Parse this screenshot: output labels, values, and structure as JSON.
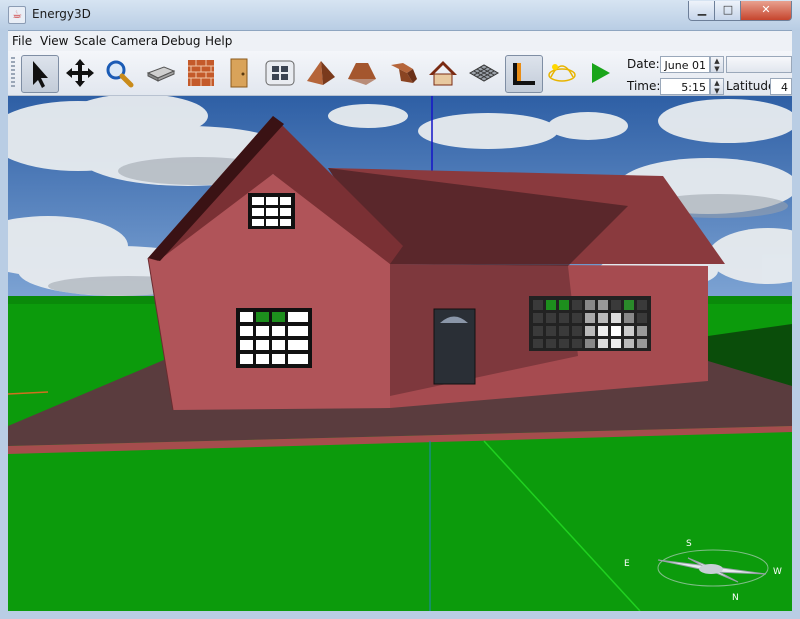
{
  "window": {
    "title": "Energy3D",
    "minimize": "▁",
    "maximize": "□",
    "close": "✕"
  },
  "menu": [
    "File",
    "View",
    "Scale",
    "Camera",
    "Debug",
    "Help"
  ],
  "toolbar": {
    "tools": [
      {
        "name": "select-tool",
        "icon": "arrow-cursor-icon",
        "active": true
      },
      {
        "name": "move-tool",
        "icon": "move-arrows-icon"
      },
      {
        "name": "zoom-tool",
        "icon": "magnifier-icon"
      },
      {
        "name": "foundation-tool",
        "icon": "foundation-icon"
      },
      {
        "name": "wall-tool",
        "icon": "brick-wall-icon"
      },
      {
        "name": "door-tool",
        "icon": "door-icon"
      },
      {
        "name": "window-tool",
        "icon": "window-icon"
      },
      {
        "name": "pyramid-roof-tool",
        "icon": "pyramid-roof-icon"
      },
      {
        "name": "hip-roof-tool",
        "icon": "hip-roof-icon"
      },
      {
        "name": "custom-roof-tool",
        "icon": "custom-roof-icon"
      },
      {
        "name": "gable-roof-tool",
        "icon": "gable-roof-icon"
      },
      {
        "name": "floor-tool",
        "icon": "floor-grid-icon"
      },
      {
        "name": "shadow-toggle",
        "icon": "shadow-icon",
        "active": true
      },
      {
        "name": "sun-path-toggle",
        "icon": "sun-path-icon"
      },
      {
        "name": "play-sun-button",
        "icon": "play-icon"
      }
    ],
    "date_label": "Date:",
    "date_value": "June 01",
    "time_label": "Time:",
    "time_value": "5:15",
    "latitude_label": "Latitude:",
    "latitude_value": "4"
  },
  "scene": {
    "compass_letters": [
      "S",
      "E",
      "N",
      "W"
    ],
    "colors": {
      "sky": "#3b6fb5",
      "grass": "#0a9f0a",
      "wall": "#b05459",
      "roof": "#7a2f33",
      "foundation": "#5a3c3e"
    }
  }
}
